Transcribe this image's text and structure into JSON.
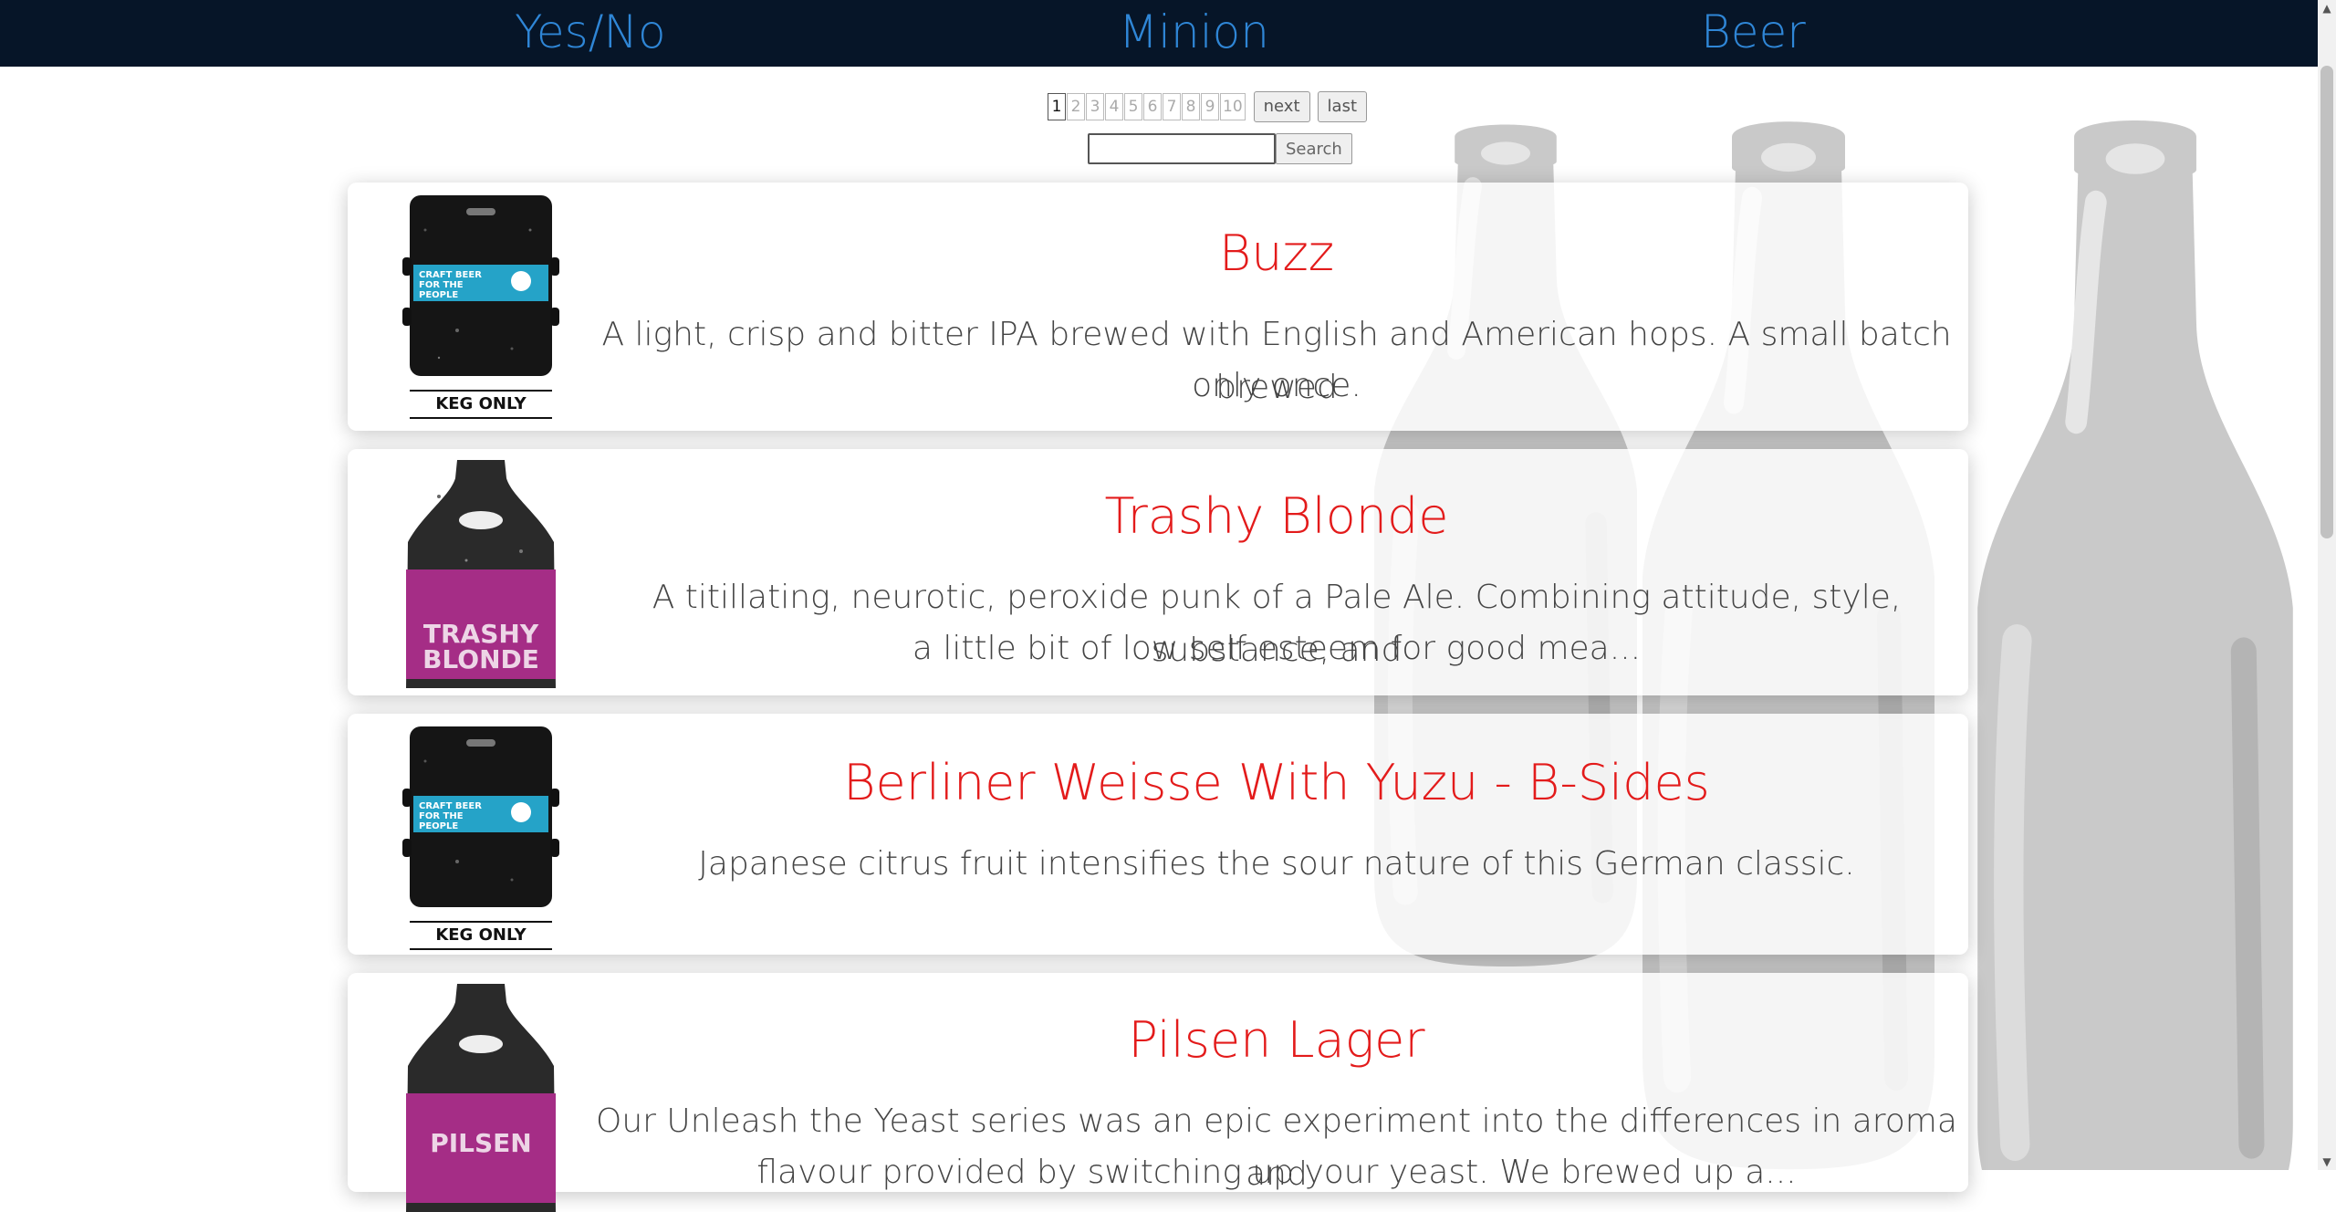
{
  "nav": {
    "items": [
      "Yes/No",
      "Minion",
      "Beer"
    ]
  },
  "pagination": {
    "pages": [
      "1",
      "2",
      "3",
      "4",
      "5",
      "6",
      "7",
      "8",
      "9",
      "10"
    ],
    "current": "1",
    "next_label": "next",
    "last_label": "last"
  },
  "search": {
    "value": "",
    "button_label": "Search"
  },
  "beers": [
    {
      "name": "Buzz",
      "description_lines": [
        "A light, crisp and bitter IPA brewed with English and American hops. A small batch brewed",
        "only once."
      ],
      "image": "keg-icon",
      "image_text": [
        "CRAFT BEER",
        "FOR THE",
        "PEOPLE",
        "KEG ONLY"
      ]
    },
    {
      "name": "Trashy Blonde",
      "description_lines": [
        "A titillating, neurotic, peroxide punk of a Pale Ale. Combining attitude, style, substance, and",
        "a little bit of low self esteem for good mea..."
      ],
      "image": "purple-bottle-icon",
      "image_text": [
        "TRASHY",
        "BLONDE"
      ]
    },
    {
      "name": "Berliner Weisse With Yuzu - B-Sides",
      "description_lines": [
        "Japanese citrus fruit intensifies the sour nature of this German classic."
      ],
      "image": "keg-icon",
      "image_text": [
        "CRAFT BEER",
        "FOR THE",
        "PEOPLE",
        "KEG ONLY"
      ]
    },
    {
      "name": "Pilsen Lager",
      "description_lines": [
        "Our Unleash the Yeast series was an epic experiment into the differences in aroma and",
        "flavour provided by switching up your yeast. We brewed up a..."
      ],
      "image": "purple-bottle-icon",
      "image_text": [
        "PILSEN"
      ]
    }
  ],
  "colors": {
    "topbar": "#061528",
    "nav_link": "#2f86d6",
    "title": "#e31b1b",
    "text": "#444444",
    "bottle_bg": "#c8c8c8"
  }
}
